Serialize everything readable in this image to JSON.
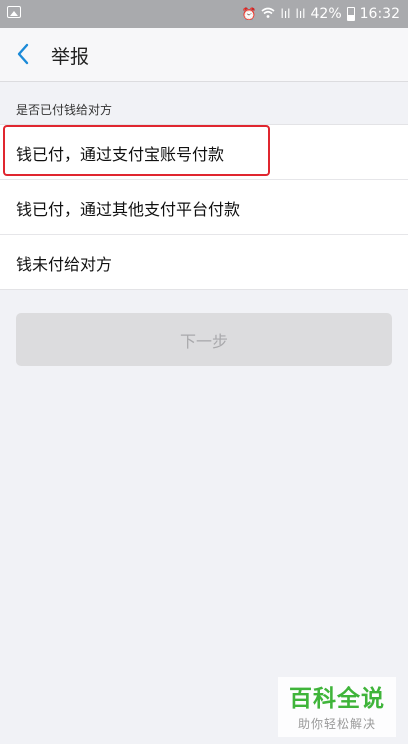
{
  "status_bar": {
    "battery": "42%",
    "time": "16:32",
    "icons": [
      "image-icon",
      "alarm-icon",
      "wifi-icon",
      "signal-icon",
      "signal-icon",
      "battery-icon"
    ],
    "signal_label_1": "lıl",
    "signal_label_2": "lıl"
  },
  "navbar": {
    "back_icon": "chevron-left-icon",
    "title": "举报"
  },
  "section": {
    "label": "是否已付钱给对方"
  },
  "options": [
    {
      "label": "钱已付，通过支付宝账号付款",
      "highlighted": true
    },
    {
      "label": "钱已付，通过其他支付平台付款",
      "highlighted": false
    },
    {
      "label": "钱未付给对方",
      "highlighted": false
    }
  ],
  "next_button": {
    "label": "下一步",
    "enabled": false
  },
  "watermark": {
    "title": "百科全说",
    "subtitle": "助你轻松解决"
  },
  "colors": {
    "accent": "#1b8ad8",
    "highlight": "#e0262f",
    "watermark_green": "#3fb43a"
  }
}
